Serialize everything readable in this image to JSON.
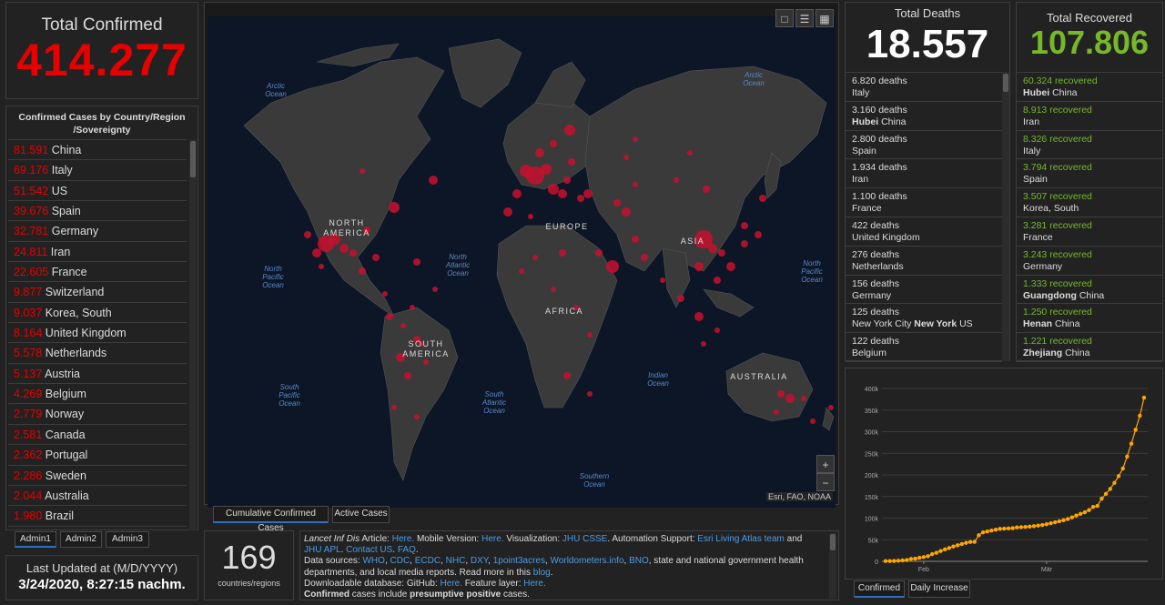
{
  "confirmed": {
    "title": "Total Confirmed",
    "value": "414.277",
    "list_title_1": "Confirmed Cases by Country/Region",
    "list_title_2": "/Sovereignty",
    "items": [
      {
        "n": "81.591",
        "name": "China"
      },
      {
        "n": "69.176",
        "name": "Italy"
      },
      {
        "n": "51.542",
        "name": "US"
      },
      {
        "n": "39.676",
        "name": "Spain"
      },
      {
        "n": "32.781",
        "name": "Germany"
      },
      {
        "n": "24.811",
        "name": "Iran"
      },
      {
        "n": "22.605",
        "name": "France"
      },
      {
        "n": "9.877",
        "name": "Switzerland"
      },
      {
        "n": "9.037",
        "name": "Korea, South"
      },
      {
        "n": "8.164",
        "name": "United Kingdom"
      },
      {
        "n": "5.578",
        "name": "Netherlands"
      },
      {
        "n": "5.137",
        "name": "Austria"
      },
      {
        "n": "4.269",
        "name": "Belgium"
      },
      {
        "n": "2.779",
        "name": "Norway"
      },
      {
        "n": "2.581",
        "name": "Canada"
      },
      {
        "n": "2.362",
        "name": "Portugal"
      },
      {
        "n": "2.286",
        "name": "Sweden"
      },
      {
        "n": "2.044",
        "name": "Australia"
      },
      {
        "n": "1.980",
        "name": "Brazil"
      }
    ]
  },
  "admin_tabs": [
    "Admin1",
    "Admin2",
    "Admin3"
  ],
  "updated": {
    "label": "Last Updated at (M/D/YYYY)",
    "value": "3/24/2020, 8:27:15 nachm."
  },
  "map": {
    "oceans": {
      "arctic_left": [
        "Arctic",
        "Ocean"
      ],
      "arctic_right": [
        "Arctic",
        "Ocean"
      ],
      "north_pacific_left": [
        "North",
        "Pacific",
        "Ocean"
      ],
      "north_atlantic": [
        "North",
        "Atlantic",
        "Ocean"
      ],
      "north_pacific_right": [
        "North",
        "Pacific",
        "Ocean"
      ],
      "south_pacific": [
        "South",
        "Pacific",
        "Ocean"
      ],
      "south_atlantic": [
        "South",
        "Atlantic",
        "Ocean"
      ],
      "indian": [
        "Indian",
        "Ocean"
      ],
      "southern": [
        "Southern",
        "Ocean"
      ]
    },
    "continents": {
      "north_america": [
        "NORTH",
        "AMERICA"
      ],
      "europe": "EUROPE",
      "asia": "ASIA",
      "africa": "AFRICA",
      "south_america": [
        "SOUTH",
        "AMERICA"
      ],
      "australia": "AUSTRALIA"
    },
    "zoom_in": "+",
    "zoom_out": "−",
    "attribution": "Esri, FAO, NOAA",
    "tabs": [
      "Cumulative Confirmed Cases",
      "Active Cases"
    ]
  },
  "countries": {
    "value": "169",
    "label": "countries/regions"
  },
  "info": {
    "line1_pre": "Lancet Inf Dis",
    "line1_text": " Article: ",
    "here1": "Here.",
    "mobile": " Mobile Version: ",
    "here2": "Here.",
    "vis": " Visualization: ",
    "jhu_csse": "JHU CSSE",
    "auto": ". Automation Support: ",
    "esri_team": "Esri Living Atlas team",
    "and": " and ",
    "jhu_apl": "JHU APL",
    "dot": ". ",
    "contact": "Contact US",
    "dot2": ". ",
    "faq": "FAQ",
    "dot3": ".",
    "sources_label": "Data sources: ",
    "sources": [
      "WHO",
      "CDC",
      "ECDC",
      "NHC",
      "DXY",
      "1point3acres",
      "Worldometers.info",
      "BNO"
    ],
    "sources_tail": ", state and national government health departments, and local media reports.  Read more in this ",
    "blog": "blog",
    "dot4": ".",
    "db_label": "Downloadable database: GitHub: ",
    "here3": "Here.",
    "feature": " Feature layer: ",
    "here4": "Here.",
    "bold1": "Confirmed",
    "mid": " cases include ",
    "bold2": "presumptive positive",
    "tail": " cases."
  },
  "deaths": {
    "title": "Total Deaths",
    "value": "18.557",
    "items": [
      {
        "n": "6.820 deaths",
        "place_bold": "",
        "place": "Italy"
      },
      {
        "n": "3.160 deaths",
        "place_bold": "Hubei",
        "place": " China"
      },
      {
        "n": "2.800 deaths",
        "place_bold": "",
        "place": "Spain"
      },
      {
        "n": "1.934 deaths",
        "place_bold": "",
        "place": "Iran"
      },
      {
        "n": "1.100 deaths",
        "place_bold": "",
        "place": "France"
      },
      {
        "n": "422 deaths",
        "place_bold": "",
        "place": "United Kingdom"
      },
      {
        "n": "276 deaths",
        "place_bold": "",
        "place": "Netherlands"
      },
      {
        "n": "156 deaths",
        "place_bold": "",
        "place": "Germany"
      },
      {
        "n": "125 deaths",
        "place_pre": "New York City ",
        "place_bold": "New York",
        "place": " US"
      },
      {
        "n": "122 deaths",
        "place_bold": "",
        "place": "Belgium"
      }
    ]
  },
  "recovered": {
    "title": "Total Recovered",
    "value": "107.806",
    "items": [
      {
        "n": "60.324 recovered",
        "place_bold": "Hubei",
        "place": " China"
      },
      {
        "n": "8.913 recovered",
        "place_bold": "",
        "place": "Iran"
      },
      {
        "n": "8.326 recovered",
        "place_bold": "",
        "place": "Italy"
      },
      {
        "n": "3.794 recovered",
        "place_bold": "",
        "place": "Spain"
      },
      {
        "n": "3.507 recovered",
        "place_bold": "",
        "place": "Korea, South"
      },
      {
        "n": "3.281 recovered",
        "place_bold": "",
        "place": "France"
      },
      {
        "n": "3.243 recovered",
        "place_bold": "",
        "place": "Germany"
      },
      {
        "n": "1.333 recovered",
        "place_bold": "Guangdong",
        "place": " China"
      },
      {
        "n": "1.250 recovered",
        "place_bold": "Henan",
        "place": " China"
      },
      {
        "n": "1.221 recovered",
        "place_bold": "Zhejiang",
        "place": " China"
      }
    ]
  },
  "chart_tabs": [
    "Confirmed",
    "Daily Increase"
  ],
  "chart_data": {
    "type": "line",
    "y_ticks": [
      "0",
      "50k",
      "100k",
      "150k",
      "200k",
      "250k",
      "300k",
      "350k",
      "400k"
    ],
    "x_tick_labels": [
      "Feb",
      "Mär"
    ],
    "x_tick_index": [
      9,
      38
    ],
    "ylim": [
      0,
      400000
    ],
    "grid": true,
    "line_color": "#ffa500",
    "series": [
      {
        "values": [
          555,
          654,
          941,
          1434,
          2118,
          2927,
          5578,
          6166,
          8234,
          9927,
          12038,
          16787,
          19881,
          23892,
          27635,
          30817,
          34391,
          37120,
          40150,
          42762,
          44802,
          45221,
          60368,
          66885,
          69030,
          71224,
          73258,
          75136,
          75639,
          76197,
          76819,
          78572,
          78958,
          79561,
          80406,
          81388,
          82746,
          84112,
          86011,
          88369,
          90306,
          92840,
          95120,
          97886,
          101800,
          105847,
          109821,
          113590,
          118620,
          125875,
          128352,
          145205,
          156101,
          167454,
          181574,
          197102,
          214821,
          242570,
          272208,
          304507,
          336953,
          378723
        ]
      }
    ]
  }
}
